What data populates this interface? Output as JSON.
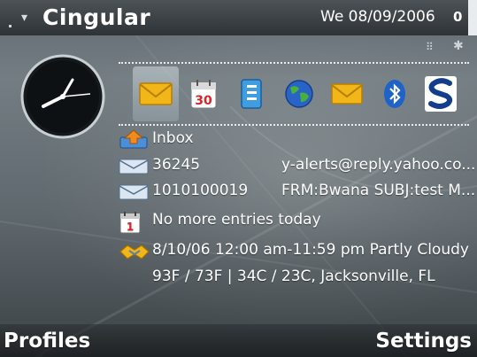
{
  "status_bar": {
    "operator": "Cingular",
    "date": "We 08/09/2006",
    "battery_digit": "0"
  },
  "app_bar": {
    "apps": [
      {
        "name": "messaging",
        "icon": "envelope-icon",
        "selected": true
      },
      {
        "name": "calendar",
        "icon": "calendar-icon",
        "day": "30"
      },
      {
        "name": "contacts",
        "icon": "contacts-icon"
      },
      {
        "name": "web",
        "icon": "globe-icon"
      },
      {
        "name": "email",
        "icon": "envelope-icon"
      },
      {
        "name": "bluetooth",
        "icon": "bluetooth-icon"
      },
      {
        "name": "app",
        "icon": "s-logo-icon"
      }
    ]
  },
  "inbox": {
    "title": "Inbox",
    "messages": [
      {
        "id": "36245",
        "preview": "y-alerts@reply.yahoo.co..."
      },
      {
        "id": "1010100019",
        "preview": "FRM:Bwana SUBJ:test M..."
      }
    ]
  },
  "calendar": {
    "icon_day": "1",
    "text": "No more entries today"
  },
  "weather": {
    "line1": "8/10/06 12:00 am-11:59 pm Partly Cloudy",
    "line2": "93F / 73F | 34C / 23C, Jacksonville, FL"
  },
  "softkeys": {
    "left": "Profiles",
    "right": "Settings"
  },
  "colors": {
    "accent_yellow": "#f2b619",
    "bluetooth_blue": "#1f63c9",
    "text": "#ffffff"
  }
}
